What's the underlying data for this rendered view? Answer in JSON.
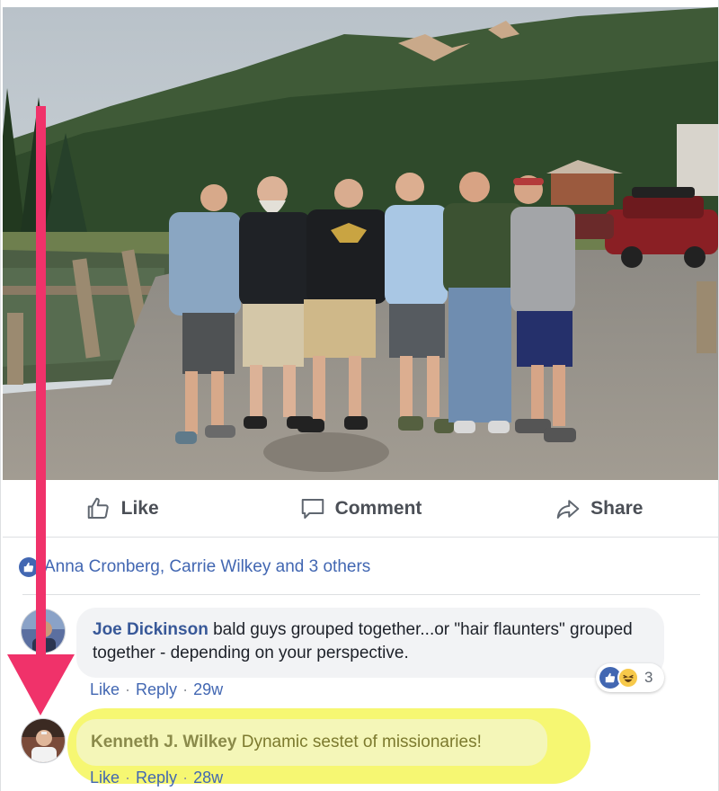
{
  "post": {
    "photo_description_icon": "group-photo",
    "actions": {
      "like": "Like",
      "comment": "Comment",
      "share": "Share"
    },
    "reactions_summary": "Anna Cronberg, Carrie Wilkey and 3 others"
  },
  "comments": [
    {
      "author": "Joe Dickinson",
      "text": "bald guys grouped together...or \"hair flaunters\" grouped together - depending on your perspective.",
      "like_label": "Like",
      "reply_label": "Reply",
      "time": "29w",
      "reaction_count": "3"
    },
    {
      "author": "Kenneth J. Wilkey",
      "text": "Dynamic sestet of missionaries!",
      "like_label": "Like",
      "reply_label": "Reply",
      "time": "28w"
    }
  ],
  "colors": {
    "link": "#385898",
    "like_blue": "#4267b2",
    "arrow": "#f0326a",
    "highlight": "#f4f54a"
  }
}
